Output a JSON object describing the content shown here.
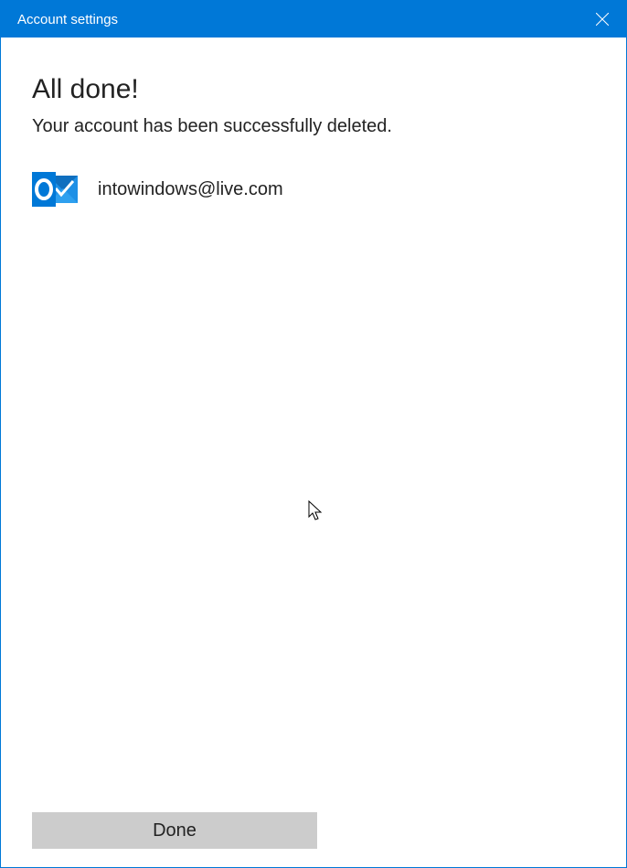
{
  "titlebar": {
    "title": "Account settings"
  },
  "content": {
    "heading": "All done!",
    "subtext": "Your account has been successfully deleted.",
    "account_email": "intowindows@live.com"
  },
  "footer": {
    "done_label": "Done"
  },
  "colors": {
    "accent": "#0078d7",
    "button_bg": "#cccccc"
  }
}
